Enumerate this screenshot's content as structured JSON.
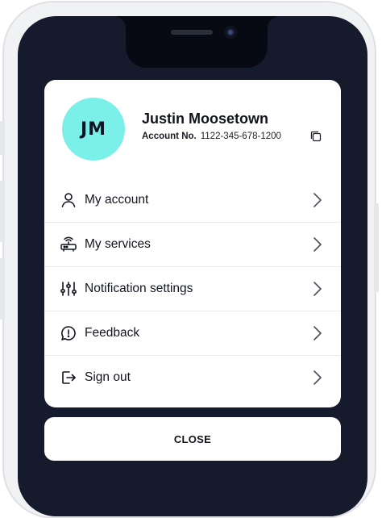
{
  "profile": {
    "initials": "JM",
    "name": "Justin Moosetown",
    "account_label": "Account No.",
    "account_number": "1122-345-678-1200",
    "copy_icon": "copy-icon",
    "avatar_color": "#7bf0e8"
  },
  "menu": {
    "items": [
      {
        "label": "My account",
        "icon": "person-icon"
      },
      {
        "label": "My services",
        "icon": "router-icon"
      },
      {
        "label": "Notification settings",
        "icon": "sliders-icon"
      },
      {
        "label": "Feedback",
        "icon": "chat-alert-icon"
      },
      {
        "label": "Sign out",
        "icon": "sign-out-icon"
      }
    ]
  },
  "close_label": "CLOSE",
  "colors": {
    "screen_background": "#151b2c",
    "card_background": "#ffffff",
    "text": "#10131a"
  }
}
